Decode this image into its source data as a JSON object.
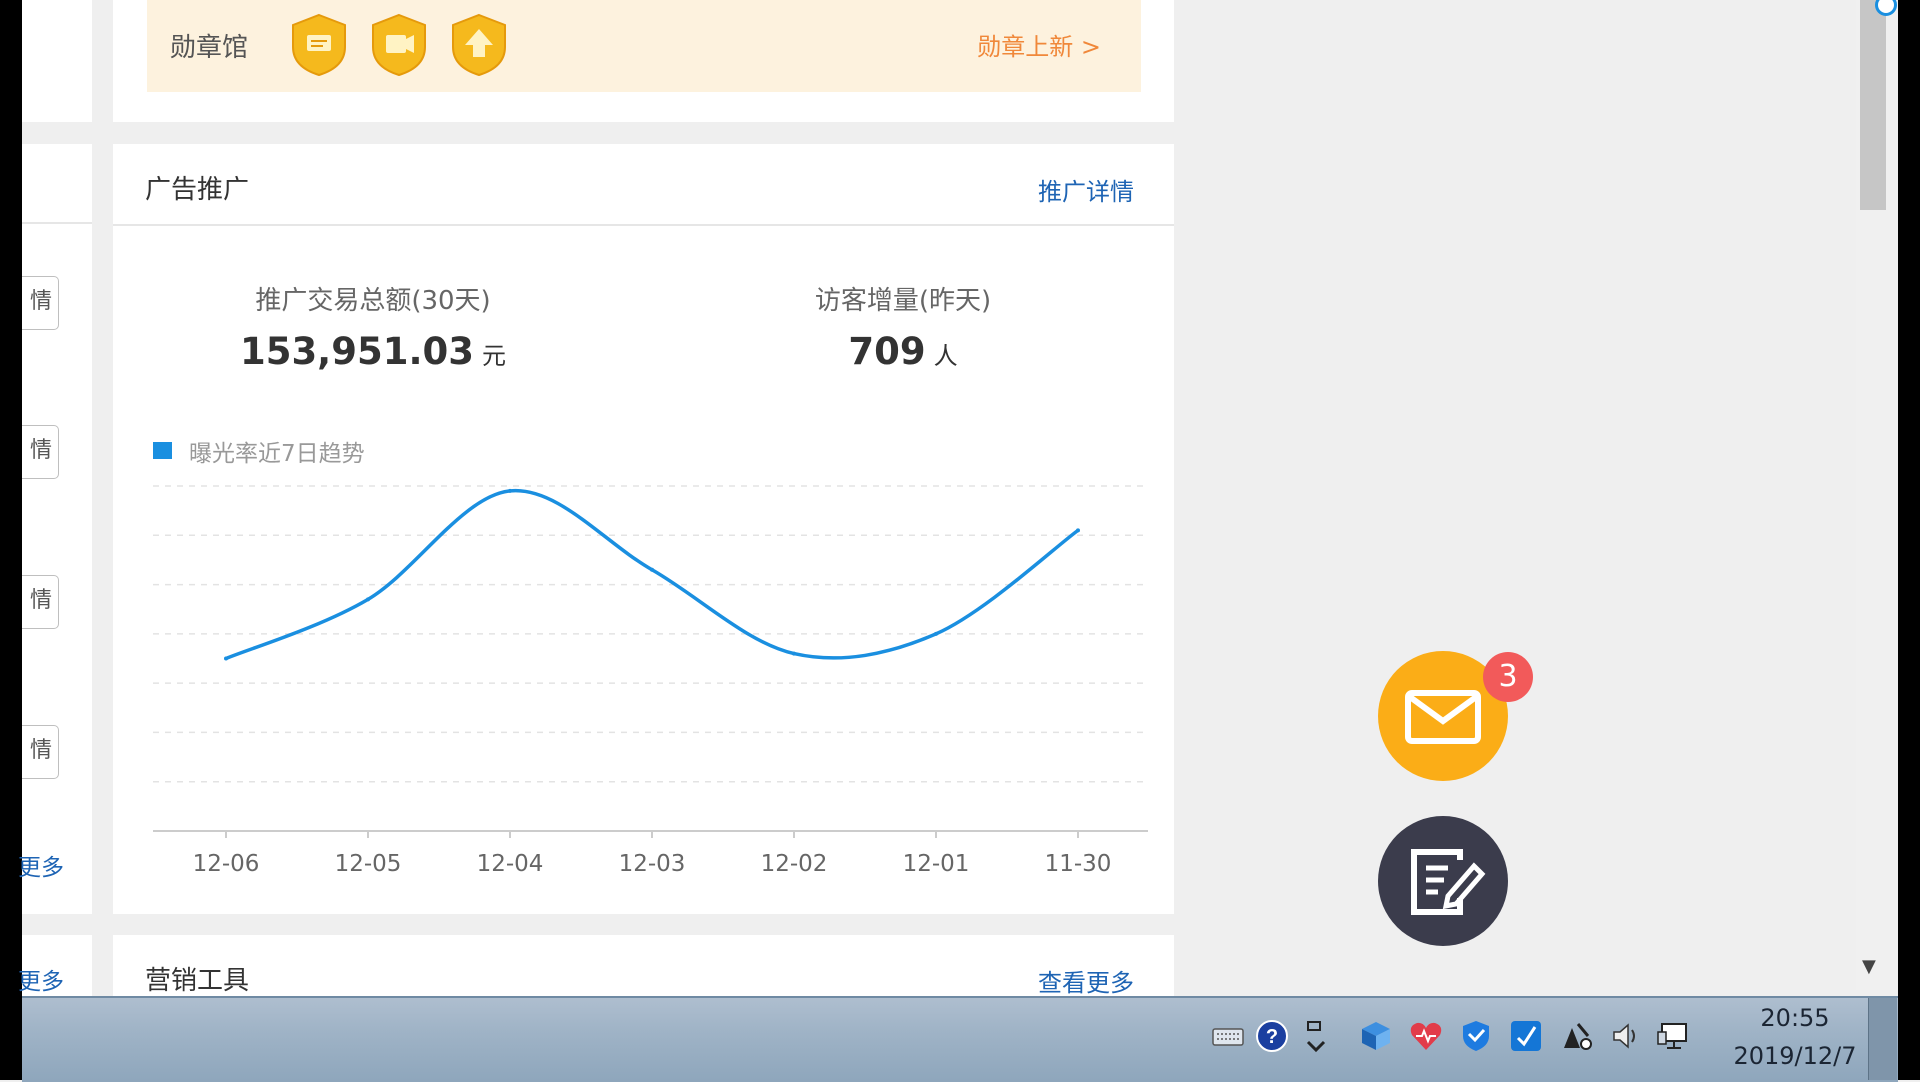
{
  "badge_section": {
    "title": "勋章馆",
    "new_link": "勋章上新 >"
  },
  "ad_card": {
    "title": "广告推广",
    "details_link": "推广详情",
    "stat_1": {
      "label": "推广交易总额(30天)",
      "value": "153,951.03",
      "unit": "元"
    },
    "stat_2": {
      "label": "访客增量(昨天)",
      "value": "709",
      "unit": "人"
    },
    "legend_label": "曝光率近7日趋势"
  },
  "chart_data": {
    "type": "line",
    "title": "",
    "categories": [
      "12-06",
      "12-05",
      "12-04",
      "12-03",
      "12-02",
      "12-01",
      "11-30"
    ],
    "series": [
      {
        "name": "曝光率近7日趋势",
        "values": [
          3.5,
          4.7,
          6.9,
          5.3,
          3.6,
          4.0,
          6.1
        ],
        "color": "#1a8fe0"
      }
    ],
    "xlabel": "",
    "ylabel": "",
    "ylim": [
      0,
      7
    ],
    "grid": true,
    "y_tick_labels_visible": false
  },
  "marketing_card": {
    "title": "营销工具",
    "more_link": "查看更多"
  },
  "left_column": {
    "button_char": "情",
    "more_label_1": "更多",
    "more_label_2": "更多"
  },
  "floating": {
    "mail_badge_count": "3"
  },
  "taskbar": {
    "time": "20:55",
    "date": "2019/12/7"
  },
  "colors": {
    "accent_blue": "#1a8fe0",
    "link_blue": "#1e64b4",
    "orange": "#fbad17",
    "badge_red": "#f25a5a"
  }
}
